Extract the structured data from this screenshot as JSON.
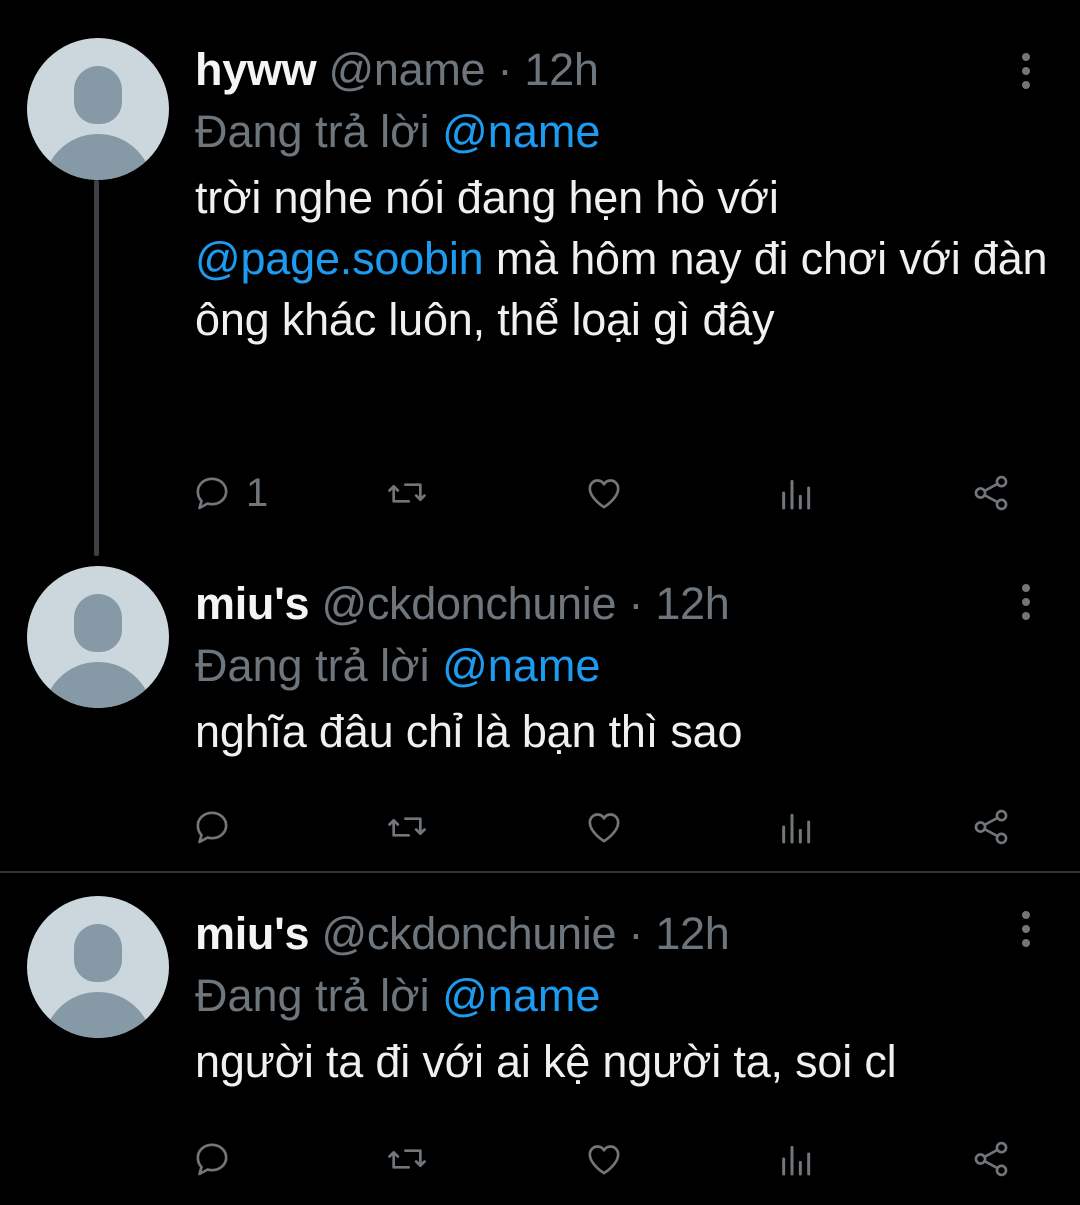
{
  "tweets": [
    {
      "display_name": "hyww",
      "handle": "@name",
      "time": "12h",
      "reply_prefix": "Đang trả lời",
      "reply_to": "@name",
      "text_parts": [
        "trời nghe nói đang hẹn hò với",
        "@page.soobin",
        "mà hôm nay đi chơi với đàn ông khác luôn, thể loại gì đây"
      ],
      "reply_count": "1"
    },
    {
      "display_name": "miu's",
      "handle": "@ckdonchunie",
      "time": "12h",
      "reply_prefix": "Đang trả lời",
      "reply_to": "@name",
      "text": "nghĩa đâu chỉ là bạn thì sao",
      "reply_count": ""
    },
    {
      "display_name": "miu's",
      "handle": "@ckdonchunie",
      "time": "12h",
      "reply_prefix": "Đang trả lời",
      "reply_to": "@name",
      "text": "người ta đi với ai kệ người ta, soi cl",
      "reply_count": ""
    }
  ],
  "separator": "·",
  "icons": [
    "avatar-placeholder",
    "more-vertical-icon",
    "reply-icon",
    "retweet-icon",
    "like-icon",
    "views-icon",
    "share-icon"
  ],
  "colors": {
    "background": "#000000",
    "mention": "#1d9bf0",
    "muted": "#6e767d",
    "avatar": "#ccd6dd"
  }
}
